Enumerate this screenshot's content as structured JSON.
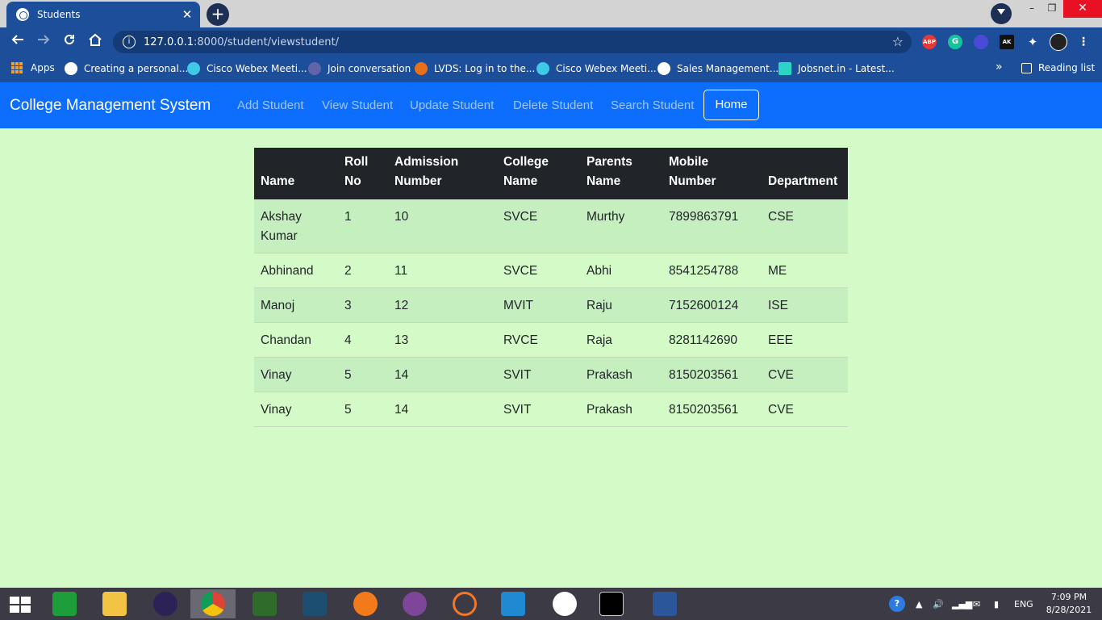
{
  "browser": {
    "tab_title": "Students",
    "tab_close": "✕",
    "new_tab": "+",
    "window_min": "–",
    "window_max": "❐",
    "window_close": "✕",
    "url_host": "127.0.0.1",
    "url_path": ":8000/student/viewstudent/",
    "extensions": [
      "ABP",
      "G",
      "AK"
    ]
  },
  "bookmarks": {
    "apps": "Apps",
    "items": [
      {
        "label": "Creating a personal...",
        "icon": "github-icon",
        "color": "#ffffff"
      },
      {
        "label": "Cisco Webex Meeti...",
        "icon": "webex-icon",
        "color": "#3ec9e6"
      },
      {
        "label": "Join conversation",
        "icon": "teams-icon",
        "color": "#6264a7"
      },
      {
        "label": "LVDS: Log in to the...",
        "icon": "lvds-icon",
        "color": "#e8701a"
      },
      {
        "label": "Cisco Webex Meeti...",
        "icon": "webex-icon",
        "color": "#3ec9e6"
      },
      {
        "label": "Sales Management...",
        "icon": "globe-icon",
        "color": "#ffffff"
      },
      {
        "label": "Jobsnet.in - Latest...",
        "icon": "jobsnet-icon",
        "color": "#2bd4c4"
      }
    ],
    "overflow": "»",
    "reading_list": "Reading list"
  },
  "navbar": {
    "brand": "College Management System",
    "links": [
      "Add Student",
      "View Student",
      "Update Student",
      "Delete Student",
      "Search Student"
    ],
    "home": "Home"
  },
  "table": {
    "headers": [
      [
        "Name"
      ],
      [
        "Roll",
        "No"
      ],
      [
        "Admission",
        "Number"
      ],
      [
        "College",
        "Name"
      ],
      [
        "Parents",
        "Name"
      ],
      [
        "Mobile",
        "Number"
      ],
      [
        "Department"
      ]
    ],
    "rows": [
      [
        "Akshay Kumar",
        "1",
        "10",
        "SVCE",
        "Murthy",
        "7899863791",
        "CSE"
      ],
      [
        "Abhinand",
        "2",
        "11",
        "SVCE",
        "Abhi",
        "8541254788",
        "ME"
      ],
      [
        "Manoj",
        "3",
        "12",
        "MVIT",
        "Raju",
        "7152600124",
        "ISE"
      ],
      [
        "Chandan",
        "4",
        "13",
        "RVCE",
        "Raja",
        "8281142690",
        "EEE"
      ],
      [
        "Vinay",
        "5",
        "14",
        "SVIT",
        "Prakash",
        "8150203561",
        "CVE"
      ],
      [
        "Vinay",
        "5",
        "14",
        "SVIT",
        "Prakash",
        "8150203561",
        "CVE"
      ]
    ]
  },
  "taskbar": {
    "language": "ENG",
    "time": "7:09 PM",
    "date": "8/28/2021"
  }
}
